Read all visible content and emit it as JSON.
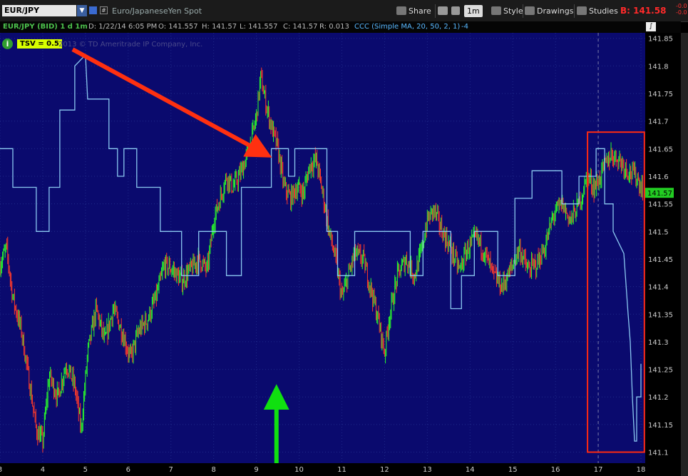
{
  "header": {
    "symbol": "EUR/JPY",
    "description": "Euro/JapaneseYen Spot",
    "share_label": "Share",
    "interval_label": "1m",
    "style_label": "Style",
    "drawings_label": "Drawings",
    "studies_label": "Studies",
    "bid_price": "B: 141.58",
    "bid_change": "-0.0\n-0.0"
  },
  "infobar": {
    "symbol_label": "EUR/JPY (BID) 1 d 1m",
    "date": "D: 1/22/14 6:05 PM",
    "open": "O: 141.557",
    "high": "H: 141.57",
    "low": "L: 141.557",
    "close": "C: 141.57",
    "range": "R: 0.013",
    "study": "CCC (Simple MA, 20, 50, 2, 1)",
    "study_value": "-4"
  },
  "overlay": {
    "tsv_label": "TSV = 0.5",
    "copyright": "2013 © TD Ameritrade IP Company, Inc."
  },
  "colors": {
    "background": "#0a0a6e",
    "bull_candle": "#2aff2a",
    "bear_candle": "#ff3a2a",
    "indicator_line": "#8ac8f0",
    "arrow_red": "#ff3010",
    "arrow_green": "#10e010",
    "highlight_box": "#ff2a10",
    "price_marker": "#22cc22"
  },
  "chart_data": {
    "type": "candlestick",
    "x_ticks": [
      "3",
      "4",
      "5",
      "6",
      "7",
      "8",
      "9",
      "10",
      "11",
      "12",
      "13",
      "14",
      "15",
      "16",
      "17",
      "18"
    ],
    "y_ticks": [
      "141.85",
      "141.8",
      "141.75",
      "141.7",
      "141.65",
      "141.6",
      "141.55",
      "141.5",
      "141.45",
      "141.4",
      "141.35",
      "141.3",
      "141.25",
      "141.2",
      "141.15",
      "141.1"
    ],
    "ylim": [
      141.08,
      141.86
    ],
    "xlim": [
      3,
      18.1
    ],
    "last_price_marker": "141.57",
    "last_price": 141.57,
    "price_path": [
      [
        3.0,
        141.44
      ],
      [
        3.15,
        141.47
      ],
      [
        3.3,
        141.38
      ],
      [
        3.5,
        141.32
      ],
      [
        3.7,
        141.22
      ],
      [
        3.85,
        141.14
      ],
      [
        4.0,
        141.12
      ],
      [
        4.15,
        141.24
      ],
      [
        4.35,
        141.2
      ],
      [
        4.55,
        141.26
      ],
      [
        4.75,
        141.22
      ],
      [
        4.9,
        141.14
      ],
      [
        5.05,
        141.28
      ],
      [
        5.25,
        141.36
      ],
      [
        5.45,
        141.3
      ],
      [
        5.65,
        141.36
      ],
      [
        5.85,
        141.32
      ],
      [
        6.05,
        141.27
      ],
      [
        6.25,
        141.32
      ],
      [
        6.45,
        141.34
      ],
      [
        6.65,
        141.38
      ],
      [
        6.85,
        141.44
      ],
      [
        7.05,
        141.43
      ],
      [
        7.25,
        141.41
      ],
      [
        7.45,
        141.43
      ],
      [
        7.65,
        141.45
      ],
      [
        7.85,
        141.43
      ],
      [
        8.0,
        141.52
      ],
      [
        8.15,
        141.56
      ],
      [
        8.3,
        141.6
      ],
      [
        8.45,
        141.58
      ],
      [
        8.6,
        141.6
      ],
      [
        8.75,
        141.63
      ],
      [
        8.9,
        141.67
      ],
      [
        9.0,
        141.71
      ],
      [
        9.1,
        141.78
      ],
      [
        9.2,
        141.74
      ],
      [
        9.35,
        141.69
      ],
      [
        9.5,
        141.65
      ],
      [
        9.65,
        141.58
      ],
      [
        9.8,
        141.56
      ],
      [
        9.95,
        141.58
      ],
      [
        10.1,
        141.57
      ],
      [
        10.25,
        141.62
      ],
      [
        10.4,
        141.63
      ],
      [
        10.55,
        141.57
      ],
      [
        10.7,
        141.5
      ],
      [
        10.85,
        141.45
      ],
      [
        11.0,
        141.38
      ],
      [
        11.15,
        141.42
      ],
      [
        11.3,
        141.46
      ],
      [
        11.5,
        141.45
      ],
      [
        11.7,
        141.39
      ],
      [
        11.85,
        141.34
      ],
      [
        12.0,
        141.28
      ],
      [
        12.1,
        141.34
      ],
      [
        12.3,
        141.42
      ],
      [
        12.5,
        141.45
      ],
      [
        12.7,
        141.42
      ],
      [
        12.85,
        141.46
      ],
      [
        13.0,
        141.52
      ],
      [
        13.15,
        141.54
      ],
      [
        13.35,
        141.5
      ],
      [
        13.55,
        141.47
      ],
      [
        13.75,
        141.43
      ],
      [
        13.95,
        141.47
      ],
      [
        14.15,
        141.49
      ],
      [
        14.35,
        141.46
      ],
      [
        14.55,
        141.42
      ],
      [
        14.75,
        141.4
      ],
      [
        14.95,
        141.43
      ],
      [
        15.15,
        141.47
      ],
      [
        15.35,
        141.43
      ],
      [
        15.55,
        141.44
      ],
      [
        15.75,
        141.47
      ],
      [
        15.95,
        141.53
      ],
      [
        16.15,
        141.55
      ],
      [
        16.35,
        141.52
      ],
      [
        16.55,
        141.55
      ],
      [
        16.75,
        141.6
      ],
      [
        16.9,
        141.58
      ],
      [
        17.0,
        141.59
      ],
      [
        17.15,
        141.62
      ],
      [
        17.3,
        141.64
      ],
      [
        17.5,
        141.63
      ],
      [
        17.7,
        141.61
      ],
      [
        17.9,
        141.6
      ],
      [
        18.0,
        141.58
      ]
    ],
    "indicator_path": [
      [
        3.0,
        141.65
      ],
      [
        3.3,
        141.65
      ],
      [
        3.3,
        141.58
      ],
      [
        3.85,
        141.58
      ],
      [
        3.85,
        141.5
      ],
      [
        4.15,
        141.5
      ],
      [
        4.15,
        141.58
      ],
      [
        4.4,
        141.58
      ],
      [
        4.4,
        141.72
      ],
      [
        4.75,
        141.72
      ],
      [
        4.75,
        141.8
      ],
      [
        5.0,
        141.82
      ],
      [
        5.05,
        141.74
      ],
      [
        5.55,
        141.74
      ],
      [
        5.55,
        141.65
      ],
      [
        5.75,
        141.65
      ],
      [
        5.75,
        141.6
      ],
      [
        5.9,
        141.6
      ],
      [
        5.9,
        141.65
      ],
      [
        6.2,
        141.65
      ],
      [
        6.2,
        141.58
      ],
      [
        6.75,
        141.58
      ],
      [
        6.75,
        141.5
      ],
      [
        7.25,
        141.5
      ],
      [
        7.25,
        141.42
      ],
      [
        7.65,
        141.42
      ],
      [
        7.65,
        141.5
      ],
      [
        8.3,
        141.5
      ],
      [
        8.3,
        141.42
      ],
      [
        8.65,
        141.42
      ],
      [
        8.65,
        141.58
      ],
      [
        9.35,
        141.58
      ],
      [
        9.35,
        141.65
      ],
      [
        9.75,
        141.65
      ],
      [
        9.75,
        141.6
      ],
      [
        9.9,
        141.6
      ],
      [
        9.9,
        141.65
      ],
      [
        10.65,
        141.65
      ],
      [
        10.65,
        141.5
      ],
      [
        10.9,
        141.5
      ],
      [
        10.9,
        141.42
      ],
      [
        11.3,
        141.42
      ],
      [
        11.3,
        141.5
      ],
      [
        12.6,
        141.5
      ],
      [
        12.6,
        141.42
      ],
      [
        12.9,
        141.42
      ],
      [
        12.9,
        141.5
      ],
      [
        13.55,
        141.5
      ],
      [
        13.55,
        141.36
      ],
      [
        13.8,
        141.36
      ],
      [
        13.8,
        141.42
      ],
      [
        14.1,
        141.42
      ],
      [
        14.1,
        141.5
      ],
      [
        14.65,
        141.5
      ],
      [
        14.65,
        141.42
      ],
      [
        15.05,
        141.42
      ],
      [
        15.05,
        141.56
      ],
      [
        15.45,
        141.56
      ],
      [
        15.45,
        141.61
      ],
      [
        16.15,
        141.61
      ],
      [
        16.15,
        141.55
      ],
      [
        16.55,
        141.55
      ],
      [
        16.55,
        141.6
      ],
      [
        16.95,
        141.6
      ],
      [
        16.95,
        141.65
      ],
      [
        17.15,
        141.65
      ],
      [
        17.15,
        141.55
      ],
      [
        17.35,
        141.55
      ],
      [
        17.35,
        141.5
      ],
      [
        17.6,
        141.46
      ],
      [
        17.7,
        141.35
      ],
      [
        17.75,
        141.3
      ],
      [
        17.8,
        141.2
      ],
      [
        17.85,
        141.12
      ],
      [
        17.9,
        141.12
      ],
      [
        17.9,
        141.2
      ],
      [
        18.0,
        141.2
      ],
      [
        18.0,
        141.26
      ]
    ]
  }
}
